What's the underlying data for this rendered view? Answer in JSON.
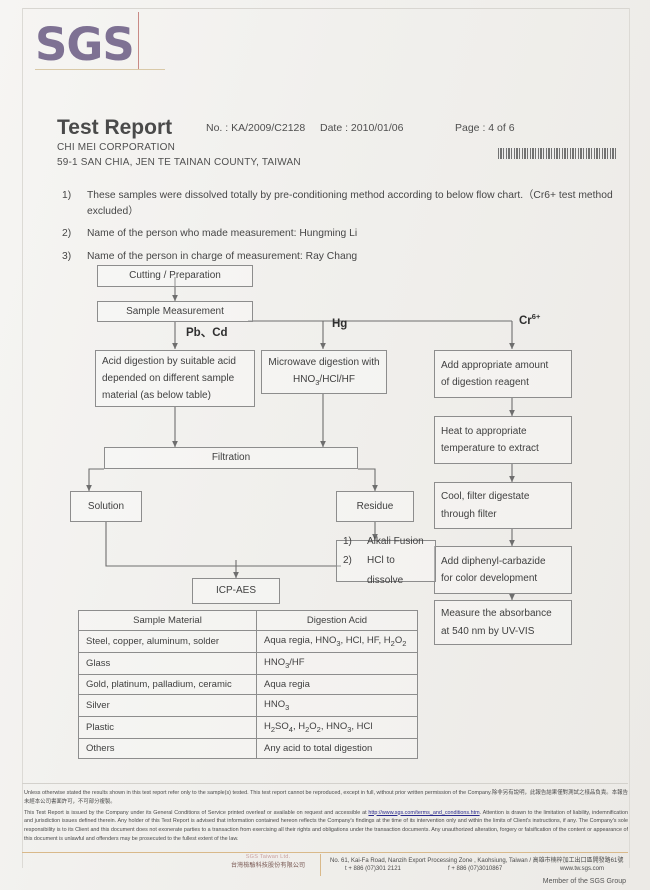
{
  "brand": {
    "logo_text": "SGS"
  },
  "header": {
    "title": "Test Report",
    "report_no": "No. : KA/2009/C2128",
    "date": "Date : 2010/01/06",
    "page": "Page  : 4 of 6",
    "company": "CHI MEI CORPORATION",
    "address": "59-1 SAN CHIA, JEN TE TAINAN COUNTY, TAIWAN",
    "barcode": "barcode"
  },
  "notes": [
    {
      "num": "1)",
      "text": "These samples were dissolved totally by pre-conditioning method according to below flow chart.（Cr6+ test method excluded）"
    },
    {
      "num": "2)",
      "text": "Name of the person who made measurement: Hungming Li"
    },
    {
      "num": "3)",
      "text": "Name of the person in charge of measurement: Ray Chang"
    }
  ],
  "flowchart": {
    "boxes": {
      "cutting": "Cutting / Preparation",
      "sample_measurement": "Sample Measurement",
      "acid_digestion_l1": "Acid digestion by suitable acid",
      "acid_digestion_l2": "depended on different sample",
      "acid_digestion_l3": "material (as below table)",
      "microwave_l1": "Microwave digestion with",
      "microwave_l2_a": "HNO",
      "microwave_l2_sub": "3",
      "microwave_l2_b": "/HCl/HF",
      "add_reagent_l1": "Add appropriate amount",
      "add_reagent_l2": "of digestion reagent",
      "heat_l1": "Heat to appropriate",
      "heat_l2": "temperature to extract",
      "cool_l1": "Cool, filter digestate",
      "cool_l2": "through filter",
      "carbazide_l1": "Add diphenyl-carbazide",
      "carbazide_l2": "for color development",
      "measure_l1": "Measure  the  absorbance",
      "measure_l2": "at 540 nm by UV-VIS",
      "filtration": "Filtration",
      "solution": "Solution",
      "residue": "Residue",
      "residue_step1_n": "1)",
      "residue_step1": "Alkali Fusion",
      "residue_step2_n": "2)",
      "residue_step2": "HCl to dissolve",
      "icp_aes": "ICP-AES"
    },
    "branch_labels": {
      "pb_cd": "Pb、Cd",
      "hg": "Hg",
      "cr_base": "Cr",
      "cr_sup": "6+"
    }
  },
  "table": {
    "headers": [
      "Sample Material",
      "Digestion Acid"
    ],
    "rows": [
      {
        "material": "Steel, copper, aluminum, solder",
        "acid_html": "Aqua regia, HNO<sub>3</sub>, HCl, HF, H<sub>2</sub>O<sub>2</sub>"
      },
      {
        "material": "Glass",
        "acid_html": "HNO<sub>3</sub>/HF"
      },
      {
        "material": "Gold, platinum, palladium, ceramic",
        "acid_html": "Aqua regia"
      },
      {
        "material": "Silver",
        "acid_html": "HNO<sub>3</sub>"
      },
      {
        "material": "Plastic",
        "acid_html": "H<sub>2</sub>SO<sub>4</sub>, H<sub>2</sub>O<sub>2</sub>, HNO<sub>3</sub>, HCl"
      },
      {
        "material": "Others",
        "acid_html": "Any acid to total digestion"
      }
    ]
  },
  "footer": {
    "legal_p1": "Unless otherwise stated the results shown in this test report refer only to the sample(s) tested. This test report cannot be reproduced, except in full, without prior written permission of the Company.除非另有說明，此報告結果僅對測試之樣品負責。本報告未經本公司書面許可，不可部分複製。",
    "legal_p2_a": "This Test Report is issued by the Company under its General Conditions of Service printed overleaf or available on request and accessible at ",
    "legal_link": "http://www.sgs.com/terms_and_conditions.htm",
    "legal_p2_b": ". Attention is drawn to the limitation of liability, indemnification and jurisdiction issues defined therein. Any holder of this Test Report is advised that information contained hereon reflects the Company's findings at the time of its intervention only and within the limits of Client's instructions, if any. The Company's sole responsibility is to its Client and this document does not exonerate parties to a transaction from exercising all their rights and obligations under the transaction documents. Any unauthorized alteration, forgery or falsification of the content or appearance of this document is unlawful and offenders may be prosecuted to the fullest extent of the law.",
    "sgs_tw_en": "SGS Taiwan Ltd.",
    "sgs_tw_zh": "台灣檢驗科技股份有限公司",
    "address": "No. 61, Kai-Fa Road, Nanzih Export Processing Zone , Kaohsiung, Taiwan / 高雄市楠梓加工出口區開發路61號",
    "tel": "t + 886 (07)301 2121",
    "fax": "f + 886 (07)3010867",
    "web": "www.tw.sgs.com",
    "member": "Member of the SGS Group"
  },
  "colors": {
    "brand_purple": "#7e7193",
    "rule_gold": "#d9b98a",
    "link": "#2a2a8c"
  }
}
